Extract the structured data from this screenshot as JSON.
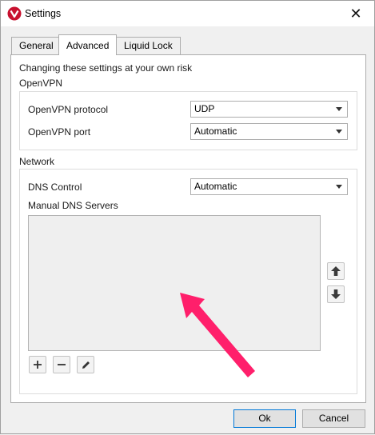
{
  "window": {
    "title": "Settings"
  },
  "tabs": [
    {
      "label": "General",
      "active": false
    },
    {
      "label": "Advanced",
      "active": true
    },
    {
      "label": "Liquid Lock",
      "active": false
    }
  ],
  "advanced": {
    "warning": "Changing these settings at your own risk",
    "openvpn": {
      "heading": "OpenVPN",
      "protocol_label": "OpenVPN protocol",
      "protocol_value": "UDP",
      "port_label": "OpenVPN port",
      "port_value": "Automatic"
    },
    "network": {
      "heading": "Network",
      "dns_control_label": "DNS Control",
      "dns_control_value": "Automatic",
      "manual_dns_label": "Manual DNS Servers",
      "manual_dns_servers": []
    }
  },
  "footer": {
    "ok_label": "Ok",
    "cancel_label": "Cancel"
  },
  "colors": {
    "annotation_arrow": "#ff1f6b",
    "app_icon": "#c8102e"
  },
  "icons": [
    "app-logo-icon",
    "close-icon",
    "move-up-icon",
    "move-down-icon",
    "add-icon",
    "remove-icon",
    "edit-icon",
    "chevron-down-icon"
  ]
}
